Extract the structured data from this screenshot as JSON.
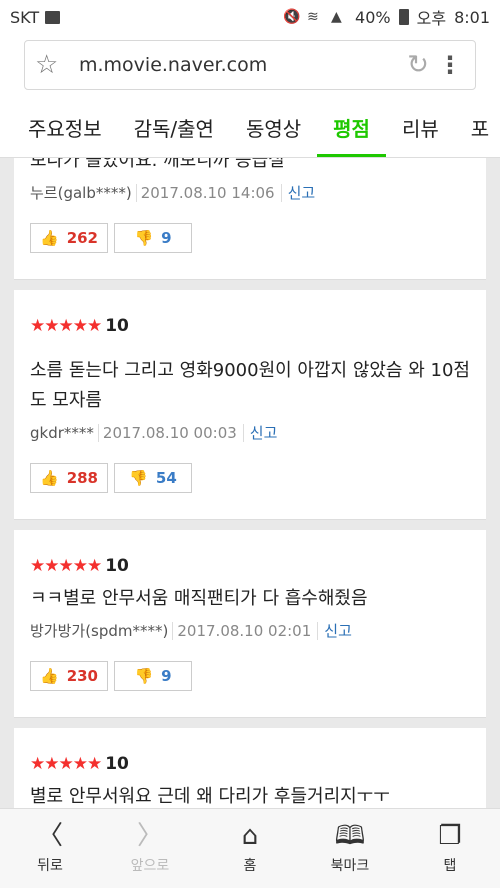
{
  "statusbar": {
    "carrier": "SKT",
    "battery": "40%",
    "ampm": "오후",
    "time": "8:01"
  },
  "browser": {
    "url": "m.movie.naver.com"
  },
  "tabs": [
    {
      "label": "주요정보"
    },
    {
      "label": "감독/출연"
    },
    {
      "label": "동영상"
    },
    {
      "label": "평점"
    },
    {
      "label": "리뷰"
    },
    {
      "label": "포"
    }
  ],
  "reviews": [
    {
      "stars": "",
      "score": "",
      "text": "보다가 졸았어요. 깨보니까 응급실",
      "author": "누르(galb****)",
      "date": "2017.08.10 14:06",
      "report": "신고",
      "up": "262",
      "down": "9"
    },
    {
      "stars": "★★★★★",
      "score": "10",
      "text": "소름 돋는다 그리고 영화9000원이 아깝지 않았슴 와 10점도 모자름",
      "author": "gkdr****",
      "date": "2017.08.10 00:03",
      "report": "신고",
      "up": "288",
      "down": "54"
    },
    {
      "stars": "★★★★★",
      "score": "10",
      "text": "ㅋㅋ별로 안무서움 매직팬티가 다 흡수해줬음",
      "author": "방가방가(spdm****)",
      "date": "2017.08.10 02:01",
      "report": "신고",
      "up": "230",
      "down": "9"
    },
    {
      "stars": "★★★★★",
      "score": "10",
      "text": "별로 안무서워요 근데 왜 다리가 후들거리지ㅜㅜ"
    }
  ],
  "bottomnav": [
    {
      "label": "뒤로",
      "icon": "chevron-left-icon"
    },
    {
      "label": "앞으로",
      "icon": "chevron-right-icon"
    },
    {
      "label": "홈",
      "icon": "home-icon"
    },
    {
      "label": "북마크",
      "icon": "bookmark-icon"
    },
    {
      "label": "탭",
      "icon": "tabs-icon"
    }
  ]
}
